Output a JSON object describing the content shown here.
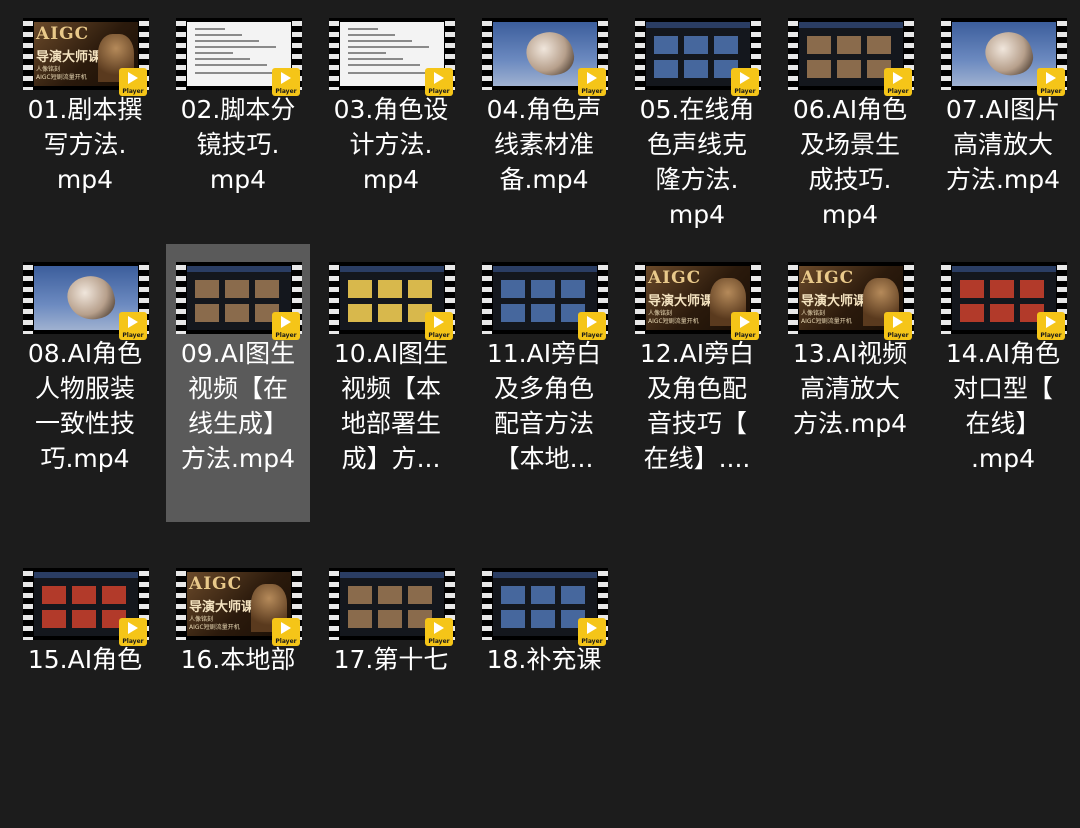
{
  "player_badge": "Player",
  "files": [
    {
      "name": "01.剧本撰写方法.mp4",
      "label": "01.剧本撰\n写方法.\nmp4",
      "thumb": "aigc"
    },
    {
      "name": "02.脚本分镜技巧.mp4",
      "label": "02.脚本分\n镜技巧.\nmp4",
      "thumb": "doc"
    },
    {
      "name": "03.角色设计方法.mp4",
      "label": "03.角色设\n计方法.\nmp4",
      "thumb": "doc"
    },
    {
      "name": "04.角色声线素材准备.mp4",
      "label": "04.角色声\n线素材准\n备.mp4",
      "thumb": "rock"
    },
    {
      "name": "05.在线角色声线克隆方法.mp4",
      "label": "05.在线角\n色声线克\n隆方法.\nmp4",
      "thumb": "dark"
    },
    {
      "name": "06.AI角色及场景生成技巧.mp4",
      "label": "06.AI角色\n及场景生\n成技巧.\nmp4",
      "thumb": "photo"
    },
    {
      "name": "07.AI图片高清放大方法.mp4",
      "label": "07.AI图片\n高清放大\n方法.mp4",
      "thumb": "rock"
    },
    {
      "name": "08.AI角色人物服装一致性技巧.mp4",
      "label": "08.AI角色\n人物服装\n一致性技\n巧.mp4",
      "thumb": "rock"
    },
    {
      "name": "09.AI图生视频【在线生成】方法.mp4",
      "label": "09.AI图生\n视频【在\n线生成】\n方法.mp4",
      "thumb": "photo",
      "selected": true
    },
    {
      "name": "10.AI图生视频【本地部署生成】方...",
      "label": "10.AI图生\n视频【本\n地部署生\n成】方...",
      "thumb": "yellow"
    },
    {
      "name": "11.AI旁白及多角色配音方法【本地...",
      "label": "11.AI旁白\n及多角色\n配音方法\n【本地...",
      "thumb": "dark"
    },
    {
      "name": "12.AI旁白及角色配音技巧【在线】....",
      "label": "12.AI旁白\n及角色配\n音技巧【\n在线】....",
      "thumb": "aigc"
    },
    {
      "name": "13.AI视频高清放大方法.mp4",
      "label": "13.AI视频\n高清放大\n方法.mp4",
      "thumb": "aigc"
    },
    {
      "name": "14.AI角色对口型【在线】.mp4",
      "label": "14.AI角色\n对口型【\n在线】\n.mp4",
      "thumb": "red"
    },
    {
      "name": "15.AI角色",
      "label": "15.AI角色",
      "thumb": "red"
    },
    {
      "name": "16.本地部",
      "label": "16.本地部",
      "thumb": "aigc"
    },
    {
      "name": "17.第十七",
      "label": "17.第十七",
      "thumb": "photo"
    },
    {
      "name": "18.补充课",
      "label": "18.补充课",
      "thumb": "dark"
    }
  ],
  "aigc_thumb": {
    "title": "AIGC",
    "subtitle": "导演大师课",
    "small": "人像铭刻\nAIGC短剧流量开机"
  }
}
